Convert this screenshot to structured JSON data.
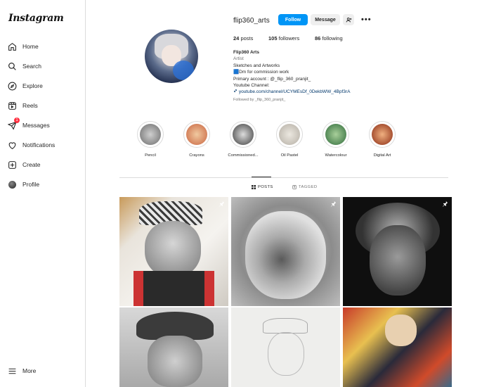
{
  "app": {
    "name": "Instagram"
  },
  "sidebar": {
    "items": [
      {
        "label": "Home",
        "icon": "home-icon"
      },
      {
        "label": "Search",
        "icon": "search-icon"
      },
      {
        "label": "Explore",
        "icon": "compass-icon"
      },
      {
        "label": "Reels",
        "icon": "reels-icon"
      },
      {
        "label": "Messages",
        "icon": "messenger-icon",
        "badge": "1"
      },
      {
        "label": "Notifications",
        "icon": "heart-icon"
      },
      {
        "label": "Create",
        "icon": "plus-square-icon"
      },
      {
        "label": "Profile",
        "icon": "avatar"
      }
    ],
    "more_label": "More"
  },
  "profile": {
    "username": "flip360_arts",
    "follow_label": "Follow",
    "message_label": "Message",
    "add_label": "+*",
    "more_label": "•••",
    "posts_count": "24",
    "posts_label": "posts",
    "followers_count": "105",
    "followers_label": "followers",
    "following_count": "86",
    "following_label": "following",
    "bio": {
      "name": "Flip360 Arts",
      "category": "Artist",
      "line1": "Sketches and Artworks",
      "line2": "🟦Dm for commission work",
      "line3": "Primary account : @_flip_360_pranjit_",
      "line4": "Youtube Channel:",
      "link": "youtube.com/channel/UCYMEsDf_0DekbWW_4Bpf3rA"
    },
    "followed_by": "Followed by _flip_360_pranjit_"
  },
  "highlights": [
    {
      "label": "Pencil",
      "color": "#9a9a9a"
    },
    {
      "label": "Crayons",
      "color": "#d7a07a"
    },
    {
      "label": "Commissioned...",
      "color": "#6e6e6e"
    },
    {
      "label": "Oil Pastel",
      "color": "#c8c4bd"
    },
    {
      "label": "Watercolour",
      "color": "#4f8b4a"
    },
    {
      "label": "Digital Art",
      "color": "#c84a22"
    }
  ],
  "tabs": [
    {
      "label": "POSTS",
      "icon": "grid-icon",
      "active": true
    },
    {
      "label": "TAGGED",
      "icon": "tag-icon",
      "active": false
    }
  ],
  "colors": {
    "accent": "#0095f6",
    "badge": "#ff3040",
    "border": "#dbdbdb"
  }
}
